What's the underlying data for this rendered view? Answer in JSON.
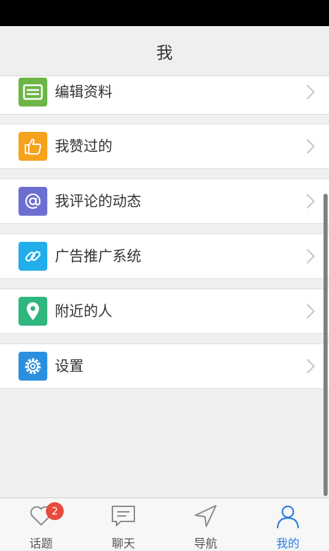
{
  "header": {
    "title": "我"
  },
  "menu": {
    "items": [
      {
        "label": "编辑资料",
        "icon": "edit-profile-icon",
        "color": "#6db545"
      },
      {
        "label": "我赞过的",
        "icon": "thumbs-up-icon",
        "color": "#f6a21d"
      },
      {
        "label": "我评论的动态",
        "icon": "at-icon",
        "color": "#6c6fd0"
      },
      {
        "label": "广告推广系统",
        "icon": "link-icon",
        "color": "#21aeea"
      },
      {
        "label": "附近的人",
        "icon": "location-pin-icon",
        "color": "#2fb67e"
      },
      {
        "label": "设置",
        "icon": "gear-icon",
        "color": "#2b8fe0"
      }
    ]
  },
  "tabbar": {
    "tabs": [
      {
        "label": "话题",
        "icon": "heart-icon",
        "badge": "2"
      },
      {
        "label": "聊天",
        "icon": "chat-icon"
      },
      {
        "label": "导航",
        "icon": "navigation-arrow-icon"
      },
      {
        "label": "我的",
        "icon": "person-icon",
        "active": true
      }
    ],
    "accent_color": "#2d7fe0"
  }
}
